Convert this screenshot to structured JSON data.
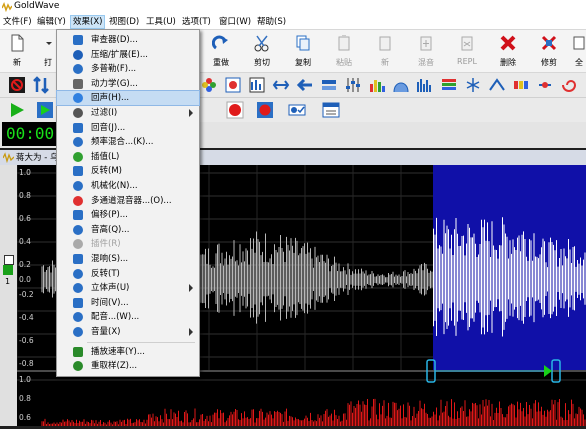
{
  "app": {
    "title": "GoldWave"
  },
  "menubar": {
    "items": [
      {
        "label": "文件(F)"
      },
      {
        "label": "编辑(Y)"
      },
      {
        "label": "效果(X)"
      },
      {
        "label": "视图(D)"
      },
      {
        "label": "工具(U)"
      },
      {
        "label": "选项(T)"
      },
      {
        "label": "窗口(W)"
      },
      {
        "label": "帮助(S)"
      }
    ],
    "active_index": 2
  },
  "toolbar": {
    "buttons": [
      {
        "label": "新",
        "icon": "new-file-icon"
      },
      {
        "label": "打",
        "icon": "open-icon"
      },
      {
        "label": "重做",
        "icon": "redo-icon"
      },
      {
        "label": "剪切",
        "icon": "scissors-icon"
      },
      {
        "label": "复制",
        "icon": "copy-icon"
      },
      {
        "label": "粘贴",
        "icon": "paste-icon",
        "disabled": true
      },
      {
        "label": "新",
        "icon": "paste-new-icon",
        "disabled": true
      },
      {
        "label": "混音",
        "icon": "mix-icon",
        "disabled": true
      },
      {
        "label": "REPL",
        "icon": "replace-icon",
        "disabled": true
      },
      {
        "label": "删除",
        "icon": "delete-icon"
      },
      {
        "label": "修剪",
        "icon": "trim-icon"
      },
      {
        "label": "全",
        "icon": "select-all-icon"
      }
    ]
  },
  "transport": {
    "time": "00:00:00"
  },
  "document": {
    "tab_title": "蒋大为 - 乌苏"
  },
  "axis": {
    "top": [
      "1.0",
      "0.8",
      "0.6",
      "0.4",
      "0.2",
      "0.0",
      "-0.2",
      "-0.4",
      "-0.6",
      "-0.8"
    ],
    "bottom": [
      "1.0",
      "0.8",
      "0.6"
    ]
  },
  "effects_menu": {
    "items": [
      {
        "label": "审查器(D)...",
        "icon": "inspector-icon"
      },
      {
        "label": "压缩/扩展(E)...",
        "icon": "compress-icon"
      },
      {
        "label": "多普勒(F)...",
        "icon": "doppler-icon"
      },
      {
        "label": "动力学(G)...",
        "icon": "dynamics-icon"
      },
      {
        "label": "回声(H)...",
        "icon": "echo-icon",
        "highlighted": true
      },
      {
        "label": "过滤(I)",
        "icon": "filter-icon",
        "submenu": true
      },
      {
        "label": "回音(J)...",
        "icon": "reverb-icon"
      },
      {
        "label": "频率混合...(K)...",
        "icon": "freq-mix-icon"
      },
      {
        "label": "插值(L)",
        "icon": "interpolate-icon"
      },
      {
        "label": "反转(M)",
        "icon": "invert-icon"
      },
      {
        "label": "机械化(N)...",
        "icon": "mechanize-icon"
      },
      {
        "label": "多通道混音器...(O)...",
        "icon": "channel-mixer-icon"
      },
      {
        "label": "偏移(P)...",
        "icon": "offset-icon"
      },
      {
        "label": "音高(Q)...",
        "icon": "pitch-icon"
      },
      {
        "label": "插件(R)",
        "icon": "plugin-icon",
        "disabled": true
      },
      {
        "label": "混响(S)...",
        "icon": "resonance-icon"
      },
      {
        "label": "反转(T)",
        "icon": "reverse-icon"
      },
      {
        "label": "立体声(U)",
        "icon": "stereo-icon",
        "submenu": true
      },
      {
        "label": "时间(V)...",
        "icon": "time-icon"
      },
      {
        "label": "配音...(W)...",
        "icon": "voiceover-icon"
      },
      {
        "label": "音量(X)",
        "icon": "volume-icon",
        "submenu": true
      },
      {
        "label": "播放速率(Y)...",
        "icon": "playback-rate-icon"
      },
      {
        "label": "重取样(Z)...",
        "icon": "resample-icon"
      }
    ]
  }
}
